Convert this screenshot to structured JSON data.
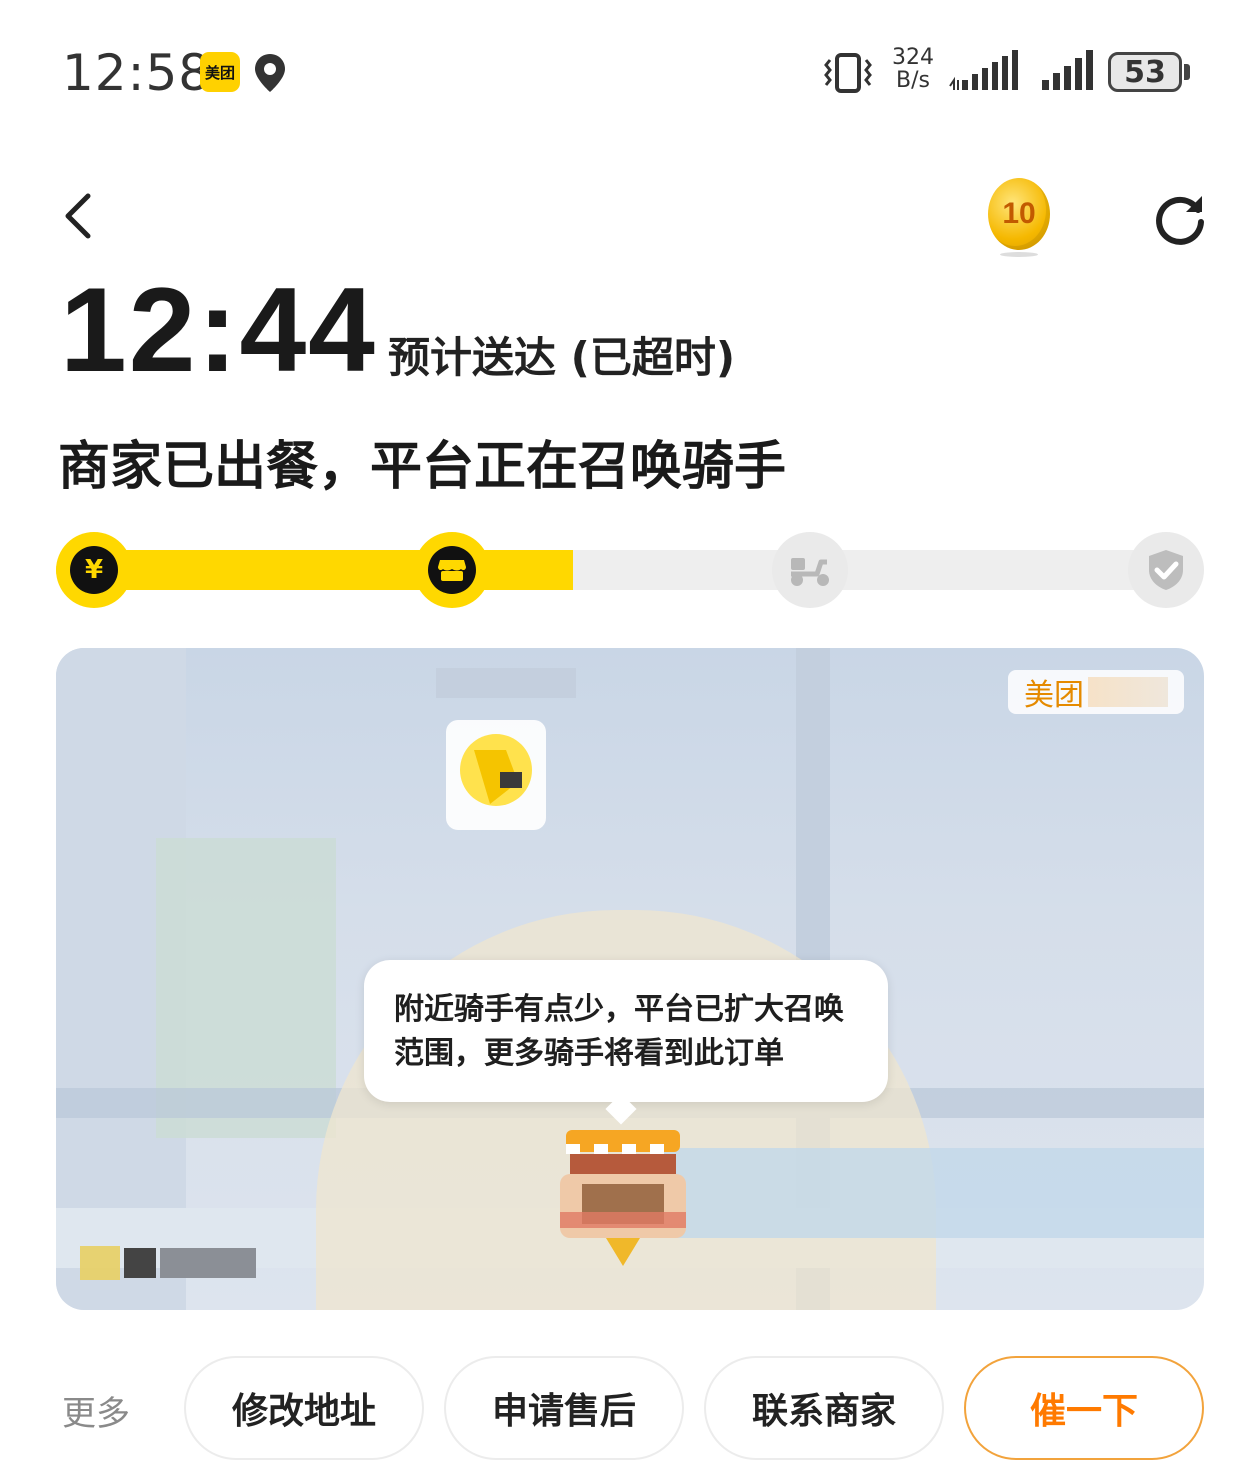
{
  "status_bar": {
    "time": "12:58",
    "app_badge": "美团",
    "net_speed_value": "324",
    "net_speed_unit": "B/s",
    "battery": "53"
  },
  "header": {
    "coin_value": "10"
  },
  "eta": {
    "time": "12:44",
    "label": "预计送达 (已超时)"
  },
  "order_status": {
    "title": "商家已出餐，平台正在召唤骑手",
    "progress_fraction": 0.45,
    "steps": [
      {
        "icon": "yen-icon",
        "state": "done"
      },
      {
        "icon": "store-icon",
        "state": "done"
      },
      {
        "icon": "scooter-icon",
        "state": "pending"
      },
      {
        "icon": "check-icon",
        "state": "pending"
      }
    ]
  },
  "map": {
    "brand_label": "美团",
    "tooltip": "附近骑手有点少，平台已扩大召唤范围，更多骑手将看到此订单"
  },
  "actions": {
    "more": "更多",
    "buttons": [
      "修改地址",
      "申请售后",
      "联系商家",
      "催一下"
    ]
  },
  "colors": {
    "accent_yellow": "#ffd800",
    "urge_orange": "#ff7a00"
  }
}
